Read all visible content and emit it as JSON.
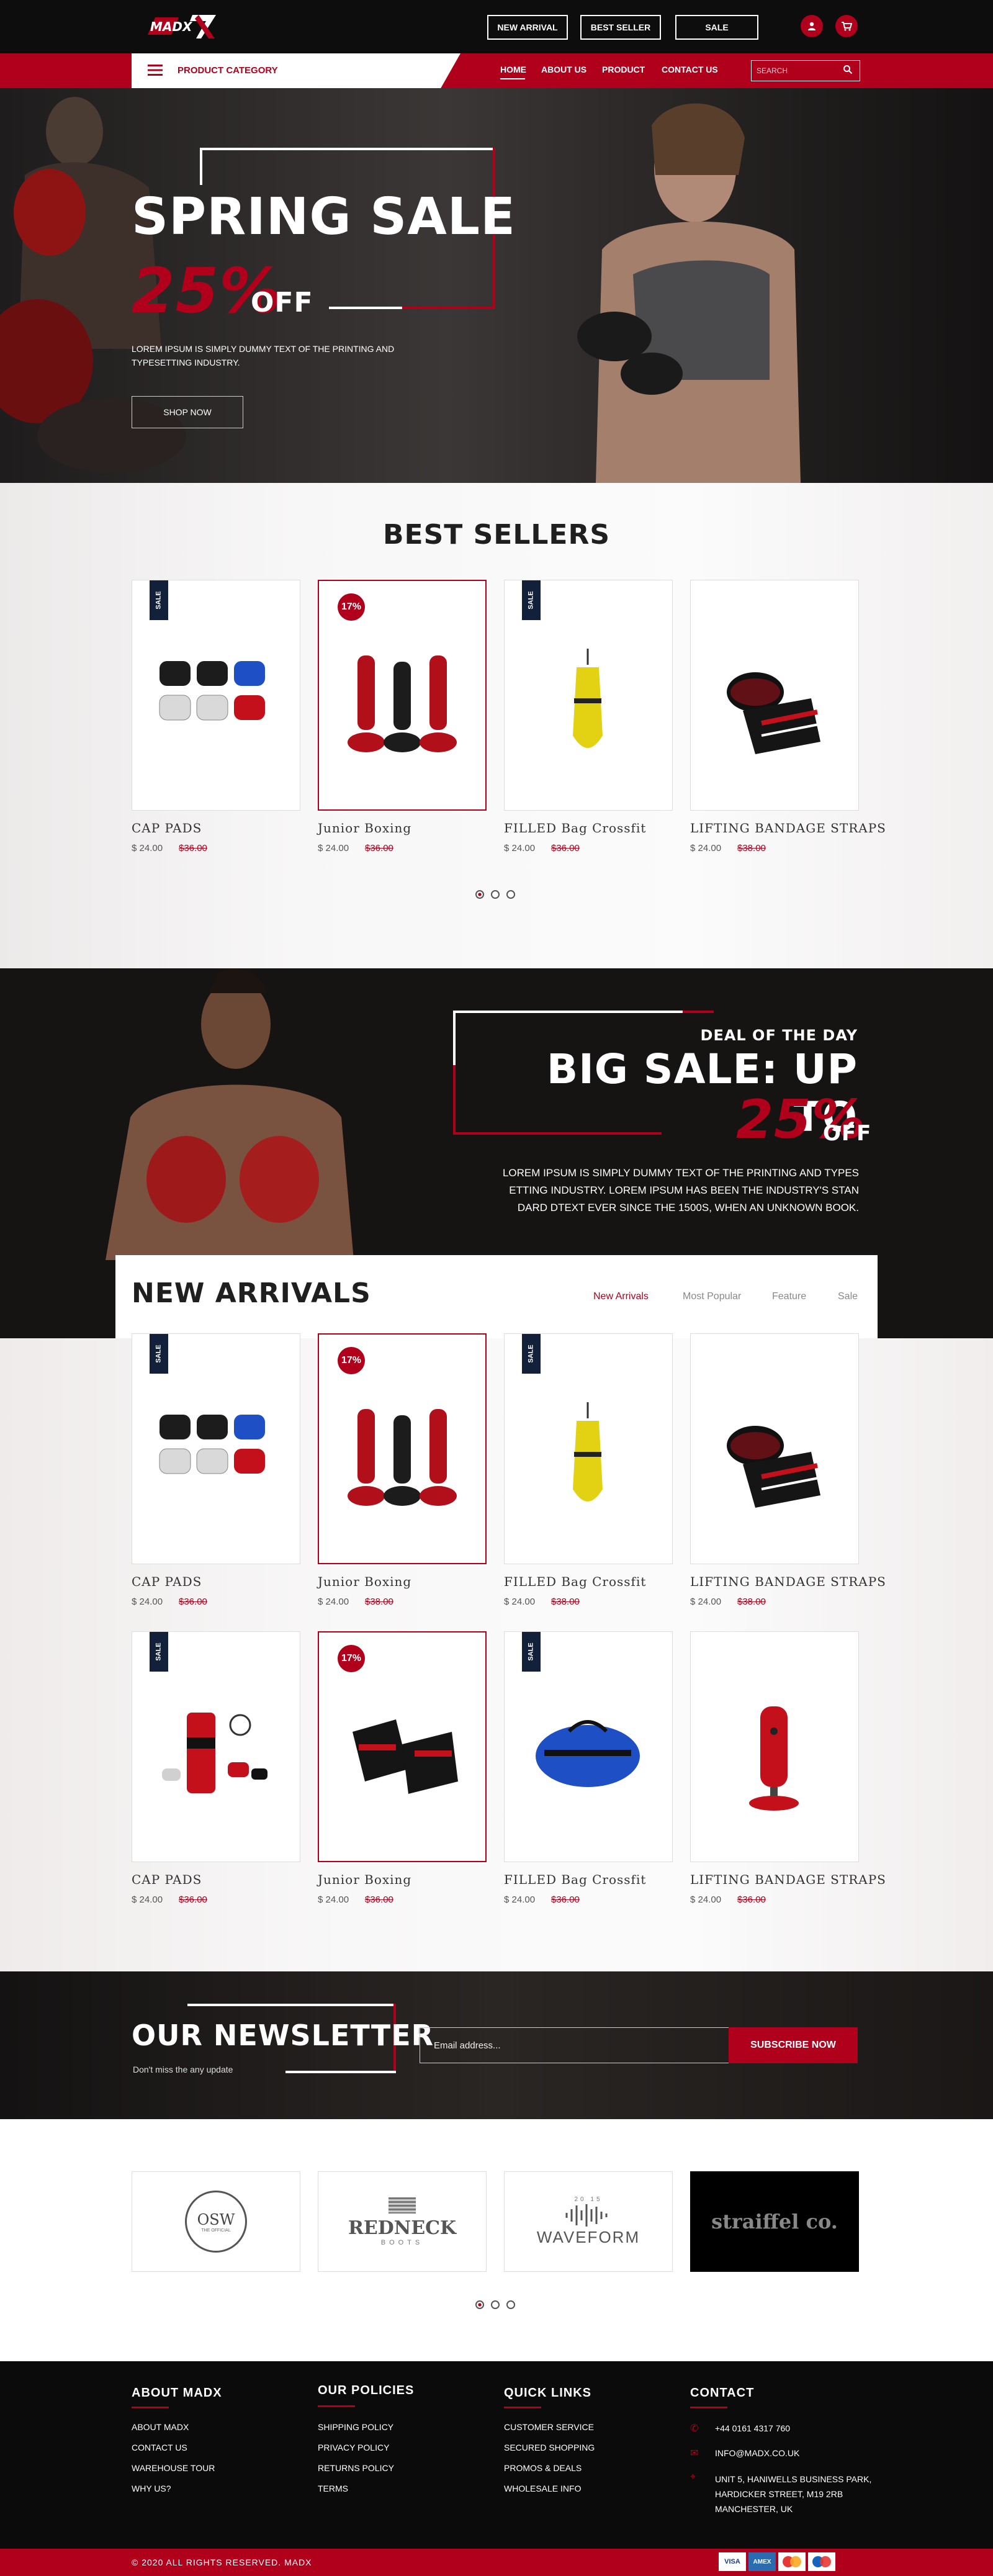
{
  "topbar": {
    "buttons": [
      "NEW ARRIVAL",
      "BEST SELLER",
      "SALE"
    ],
    "icons": [
      "user-icon",
      "cart-icon"
    ]
  },
  "logo": {
    "text": "MADX"
  },
  "nav": {
    "category_label": "PRODUCT CATEGORY",
    "links": [
      "HOME",
      "ABOUT US",
      "PRODUCT",
      "CONTACT US"
    ],
    "search_placeholder": "SEARCH"
  },
  "hero": {
    "title": "SPRING SALE",
    "percent": "25%",
    "off": "OFF",
    "text_line1": "LOREM IPSUM IS SIMPLY DUMMY TEXT OF THE PRINTING AND",
    "text_line2": "TYPESETTING INDUSTRY.",
    "button": "SHOP NOW"
  },
  "best_sellers": {
    "title": "BEST SELLERS",
    "products": [
      {
        "name": "CAP PADS",
        "price": "$ 24.00",
        "old_price": "$36.00",
        "badge": "SALE"
      },
      {
        "name": "Junior Boxing",
        "price": "$ 24.00",
        "old_price": "$36.00",
        "badge": "17%"
      },
      {
        "name": "FILLED Bag Crossfit",
        "price": "$ 24.00",
        "old_price": "$36.00",
        "badge": "SALE"
      },
      {
        "name": "LIFTING BANDAGE STRAPS",
        "price": "$ 24.00",
        "old_price": "$38.00",
        "badge": ""
      }
    ]
  },
  "deal": {
    "kicker": "DEAL OF THE DAY",
    "title": "BIG SALE: UP TO",
    "percent": "25%",
    "off": "OFF",
    "text_line1": "LOREM IPSUM IS SIMPLY DUMMY TEXT OF THE PRINTING AND TYPES",
    "text_line2": "ETTING INDUSTRY. LOREM IPSUM HAS BEEN THE INDUSTRY'S STAN",
    "text_line3": "DARD DTEXT EVER SINCE THE 1500S, WHEN AN UNKNOWN BOOK."
  },
  "new_arrivals": {
    "title": "NEW ARRIVALS",
    "tabs": [
      "New Arrivals",
      "Most Popular",
      "Feature",
      "Sale"
    ],
    "products": [
      {
        "name": "CAP PADS",
        "price": "$ 24.00",
        "old_price": "$36.00",
        "badge": "SALE"
      },
      {
        "name": "Junior Boxing",
        "price": "$ 24.00",
        "old_price": "$38.00",
        "badge": "17%"
      },
      {
        "name": "FILLED Bag Crossfit",
        "price": "$ 24.00",
        "old_price": "$38.00",
        "badge": "SALE"
      },
      {
        "name": "LIFTING BANDAGE STRAPS",
        "price": "$ 24.00",
        "old_price": "$38.00",
        "badge": ""
      },
      {
        "name": "CAP PADS",
        "price": "$ 24.00",
        "old_price": "$36.00",
        "badge": "SALE"
      },
      {
        "name": "Junior Boxing",
        "price": "$ 24.00",
        "old_price": "$36.00",
        "badge": "17%"
      },
      {
        "name": "FILLED Bag Crossfit",
        "price": "$ 24.00",
        "old_price": "$36.00",
        "badge": "SALE"
      },
      {
        "name": "LIFTING BANDAGE STRAPS",
        "price": "$ 24.00",
        "old_price": "$36.00",
        "badge": ""
      }
    ]
  },
  "newsletter": {
    "title": "OUR NEWSLETTER",
    "subtitle": "Don't miss the any update",
    "placeholder": "Email address...",
    "button": "SUBSCRIBE NOW"
  },
  "brands": [
    {
      "name": "OSW",
      "sub": "THE OFFICIAL"
    },
    {
      "name": "REDNECK",
      "sub": "BOOTS"
    },
    {
      "name": "WAVEFORM",
      "sub": "20 15"
    },
    {
      "name": "straiffel co.",
      "sub": ""
    }
  ],
  "footer": {
    "about": {
      "title": "ABOUT MADX",
      "links": [
        "ABOUT MADX",
        "CONTACT US",
        "WAREHOUSE TOUR",
        "WHY US?"
      ]
    },
    "policies": {
      "title": "OUR POLICIES",
      "links": [
        "SHIPPING POLICY",
        "PRIVACY POLICY",
        "RETURNS POLICY",
        "TERMS"
      ]
    },
    "quick": {
      "title": "QUICK LINKS",
      "links": [
        "CUSTOMER SERVICE",
        "SECURED SHOPPING",
        "PROMOS & DEALS",
        "WHOLESALE INFO"
      ]
    },
    "contact": {
      "title": "CONTACT",
      "phone": "+44 0161 4317 760",
      "email": "INFO@MADX.CO.UK",
      "address1": "UNIT 5, HANIWELLS BUSINESS PARK,",
      "address2": "HARDICKER STREET, M19 2RB",
      "address3": "MANCHESTER, UK"
    },
    "copyright": "© 2020 ALL RIGHTS RESERVED. MADX",
    "payments": [
      "VISA",
      "AMEX",
      "MC",
      "MC"
    ]
  },
  "colors": {
    "accent": "#b1001b",
    "dark": "#0e0d0d",
    "navy": "#12203a"
  }
}
